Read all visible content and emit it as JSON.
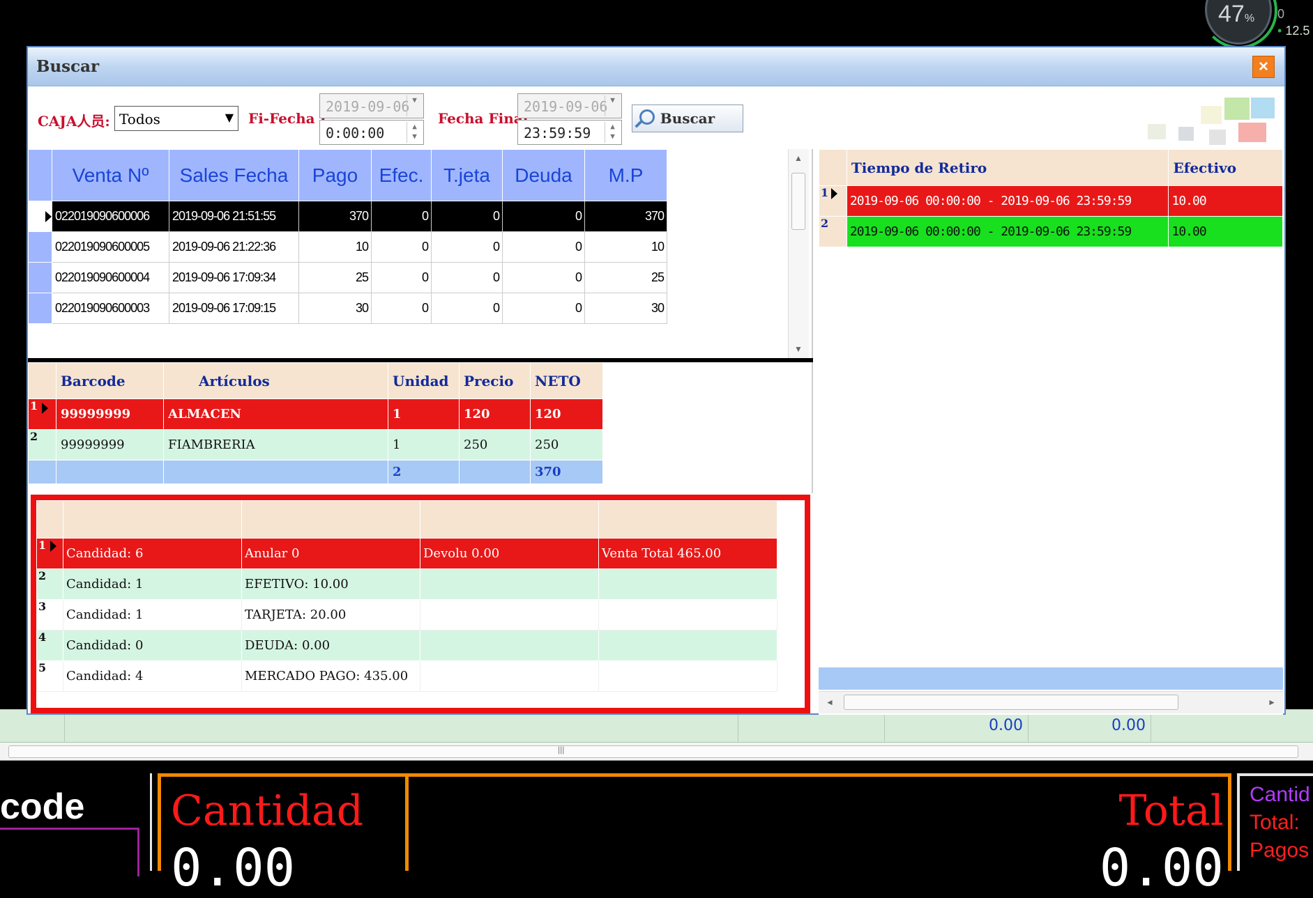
{
  "gauge": {
    "percent": "47",
    "unit": "%",
    "net_up": "0",
    "net_down": "12.5"
  },
  "dialog": {
    "title": "Buscar",
    "close_label": "×",
    "filters": {
      "cashier_label": "CAJA人员:",
      "cashier_value": "Todos",
      "start_label": "Fi-Fecha I",
      "start_date": "2019-09-06",
      "start_time": "0:00:00",
      "end_label": "Fecha Final",
      "end_date": "2019-09-06",
      "end_time": "23:59:59",
      "search_label": "Buscar"
    },
    "sales": {
      "columns": [
        "Venta Nº",
        "Sales Fecha",
        "Pago",
        "Efec.",
        "T.jeta",
        "Deuda",
        "M.P"
      ],
      "rows": [
        {
          "id": "022019090600006",
          "fecha": "2019-09-06 21:51:55",
          "pago": "370",
          "efec": "0",
          "tjeta": "0",
          "deuda": "0",
          "mp": "370"
        },
        {
          "id": "022019090600005",
          "fecha": "2019-09-06 21:22:36",
          "pago": "10",
          "efec": "0",
          "tjeta": "0",
          "deuda": "0",
          "mp": "10"
        },
        {
          "id": "022019090600004",
          "fecha": "2019-09-06 17:09:34",
          "pago": "25",
          "efec": "0",
          "tjeta": "0",
          "deuda": "0",
          "mp": "25"
        },
        {
          "id": "022019090600003",
          "fecha": "2019-09-06 17:09:15",
          "pago": "30",
          "efec": "0",
          "tjeta": "0",
          "deuda": "0",
          "mp": "30"
        }
      ]
    },
    "items": {
      "columns": [
        "Barcode",
        "Artículos",
        "Unidad",
        "Precio",
        "NETO"
      ],
      "rows": [
        {
          "n": "1",
          "barcode": "99999999",
          "articulo": "ALMACEN",
          "unidad": "1",
          "precio": "120",
          "neto": "120"
        },
        {
          "n": "2",
          "barcode": "99999999",
          "articulo": "FIAMBRERIA",
          "unidad": "1",
          "precio": "250",
          "neto": "250"
        }
      ],
      "total_unidad": "2",
      "total_neto": "370"
    },
    "summary": {
      "rows": [
        {
          "n": "1",
          "c1": "Candidad: 6",
          "c2": "Anular 0",
          "c3": "Devolu 0.00",
          "c4": "Venta Total 465.00"
        },
        {
          "n": "2",
          "c1": "Candidad: 1",
          "c2": "EFETIVO: 10.00",
          "c3": "",
          "c4": ""
        },
        {
          "n": "3",
          "c1": "Candidad: 1",
          "c2": "TARJETA: 20.00",
          "c3": "",
          "c4": ""
        },
        {
          "n": "4",
          "c1": "Candidad: 0",
          "c2": "DEUDA: 0.00",
          "c3": "",
          "c4": ""
        },
        {
          "n": "5",
          "c1": "Candidad: 4",
          "c2": "MERCADO PAGO: 435.00",
          "c3": "",
          "c4": ""
        }
      ]
    },
    "retire": {
      "columns": [
        "Tiempo de Retiro",
        "Efectivo"
      ],
      "rows": [
        {
          "n": "1",
          "tiempo": "2019-09-06 00:00:00 - 2019-09-06 23:59:59",
          "efectivo": "10.00"
        },
        {
          "n": "2",
          "tiempo": "2019-09-06 00:00:00 - 2019-09-06 23:59:59",
          "efectivo": "10.00"
        }
      ]
    }
  },
  "background": {
    "status_values": [
      "0.00",
      "0.00"
    ],
    "barcode_label": "code",
    "cantidad_label": "Cantidad",
    "cantidad_value": "0.00",
    "total_label": "Total",
    "total_value": "0.00",
    "side_labels": [
      "Cantid",
      "Total:",
      "Pagos"
    ]
  },
  "colors": {
    "selected_red": "#e81818",
    "green_row": "#18e01e",
    "light_green": "#d5f5e3",
    "header_blue": "#9fb6ff",
    "header_peach": "#f6e4d0",
    "frame_red": "#ee1010",
    "orange": "#f08a00"
  }
}
